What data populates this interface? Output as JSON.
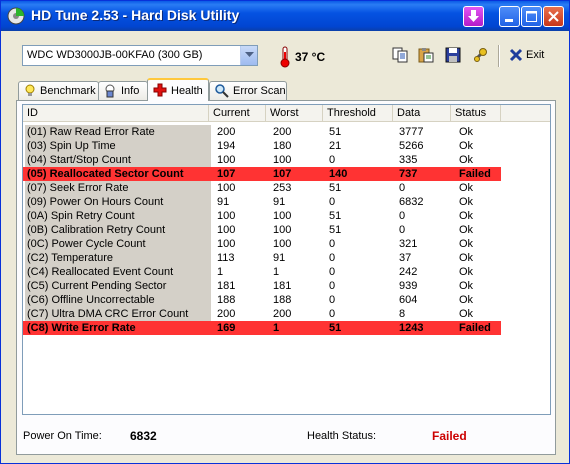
{
  "window": {
    "title": "HD Tune 2.53 - Hard Disk Utility"
  },
  "toolbar": {
    "drive": "WDC WD3000JB-00KFA0 (300 GB)",
    "temperature": "37 °C",
    "exit_label": "Exit"
  },
  "tabs": [
    {
      "label": "Benchmark",
      "icon": "lightbulb-icon"
    },
    {
      "label": "Info",
      "icon": "info-icon"
    },
    {
      "label": "Health",
      "icon": "health-cross-icon",
      "active": true
    },
    {
      "label": "Error Scan",
      "icon": "magnifier-icon"
    }
  ],
  "table": {
    "columns": [
      "ID",
      "Current",
      "Worst",
      "Threshold",
      "Data",
      "Status"
    ],
    "rows": [
      {
        "id": "(01) Raw Read Error Rate",
        "current": "200",
        "worst": "200",
        "threshold": "51",
        "data": "3777",
        "status": "Ok",
        "failed": false
      },
      {
        "id": "(03) Spin Up Time",
        "current": "194",
        "worst": "180",
        "threshold": "21",
        "data": "5266",
        "status": "Ok",
        "failed": false
      },
      {
        "id": "(04) Start/Stop Count",
        "current": "100",
        "worst": "100",
        "threshold": "0",
        "data": "335",
        "status": "Ok",
        "failed": false
      },
      {
        "id": "(05) Reallocated Sector Count",
        "current": "107",
        "worst": "107",
        "threshold": "140",
        "data": "737",
        "status": "Failed",
        "failed": true
      },
      {
        "id": "(07) Seek Error Rate",
        "current": "100",
        "worst": "253",
        "threshold": "51",
        "data": "0",
        "status": "Ok",
        "failed": false
      },
      {
        "id": "(09) Power On Hours Count",
        "current": "91",
        "worst": "91",
        "threshold": "0",
        "data": "6832",
        "status": "Ok",
        "failed": false
      },
      {
        "id": "(0A) Spin Retry Count",
        "current": "100",
        "worst": "100",
        "threshold": "51",
        "data": "0",
        "status": "Ok",
        "failed": false
      },
      {
        "id": "(0B) Calibration Retry Count",
        "current": "100",
        "worst": "100",
        "threshold": "51",
        "data": "0",
        "status": "Ok",
        "failed": false
      },
      {
        "id": "(0C) Power Cycle Count",
        "current": "100",
        "worst": "100",
        "threshold": "0",
        "data": "321",
        "status": "Ok",
        "failed": false
      },
      {
        "id": "(C2) Temperature",
        "current": "113",
        "worst": "91",
        "threshold": "0",
        "data": "37",
        "status": "Ok",
        "failed": false
      },
      {
        "id": "(C4) Reallocated Event Count",
        "current": "1",
        "worst": "1",
        "threshold": "0",
        "data": "242",
        "status": "Ok",
        "failed": false
      },
      {
        "id": "(C5) Current Pending Sector",
        "current": "181",
        "worst": "181",
        "threshold": "0",
        "data": "939",
        "status": "Ok",
        "failed": false
      },
      {
        "id": "(C6) Offline Uncorrectable",
        "current": "188",
        "worst": "188",
        "threshold": "0",
        "data": "604",
        "status": "Ok",
        "failed": false
      },
      {
        "id": "(C7) Ultra DMA CRC Error Count",
        "current": "200",
        "worst": "200",
        "threshold": "0",
        "data": "8",
        "status": "Ok",
        "failed": false
      },
      {
        "id": "(C8) Write Error Rate",
        "current": "169",
        "worst": "1",
        "threshold": "51",
        "data": "1243",
        "status": "Failed",
        "failed": true
      }
    ]
  },
  "footer": {
    "power_on_label": "Power On Time:",
    "power_on_value": "6832",
    "health_label": "Health Status:",
    "health_value": "Failed"
  },
  "colors": {
    "failed_row": "#FF3333",
    "failed_text": "#CC0000",
    "title_blue": "#0553E2"
  }
}
